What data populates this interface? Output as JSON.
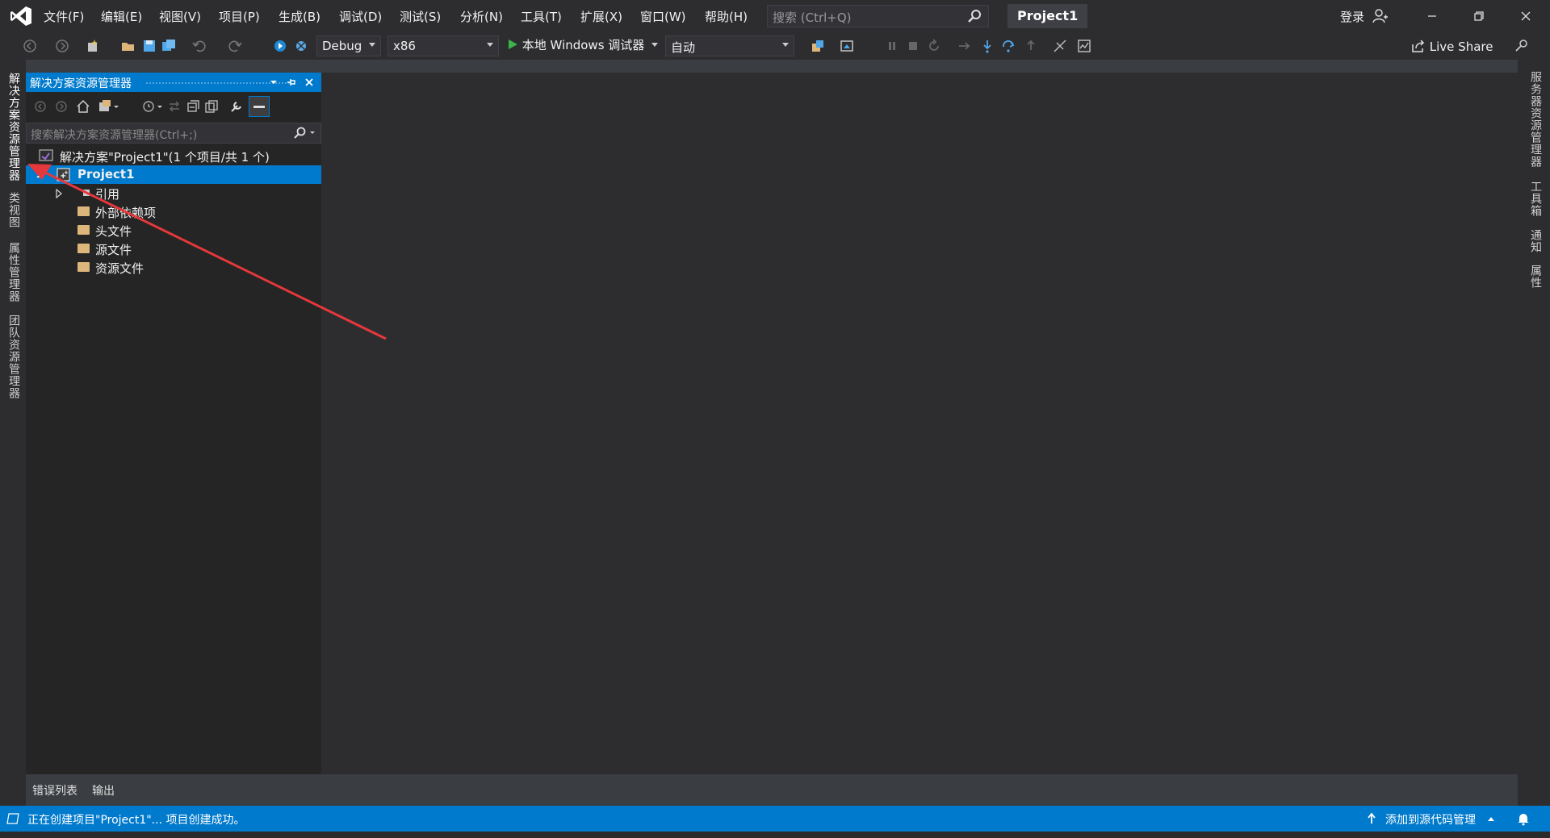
{
  "titlebar": {
    "menus": [
      "文件(F)",
      "编辑(E)",
      "视图(V)",
      "项目(P)",
      "生成(B)",
      "调试(D)",
      "测试(S)",
      "分析(N)",
      "工具(T)",
      "扩展(X)",
      "窗口(W)",
      "帮助(H)"
    ],
    "search_placeholder": "搜索 (Ctrl+Q)",
    "project_title": "Project1",
    "login": "登录"
  },
  "toolbar": {
    "config": "Debug",
    "platform": "x86",
    "run_label": "本地 Windows 调试器",
    "mode": "自动",
    "live_share": "Live Share"
  },
  "left_tabs": [
    "解决方案资源管理器",
    "类视图",
    "属性管理器",
    "团队资源管理器"
  ],
  "right_tabs": [
    "服务器资源管理器",
    "工具箱",
    "通知",
    "属性"
  ],
  "solution_explorer": {
    "title": "解决方案资源管理器",
    "search_placeholder": "搜索解决方案资源管理器(Ctrl+;)",
    "solution": "解决方案\"Project1\"(1 个项目/共 1 个)",
    "project": "Project1",
    "items": [
      "引用",
      "外部依赖项",
      "头文件",
      "源文件",
      "资源文件"
    ]
  },
  "bottom_tabs": [
    "错误列表",
    "输出"
  ],
  "status": {
    "message": "正在创建项目\"Project1\"... 项目创建成功。",
    "source_control": "添加到源代码管理"
  },
  "colors": {
    "accent": "#007acc",
    "chrome": "#2d2d30",
    "panel": "#252526",
    "annotation_arrow": "#e5383b"
  }
}
